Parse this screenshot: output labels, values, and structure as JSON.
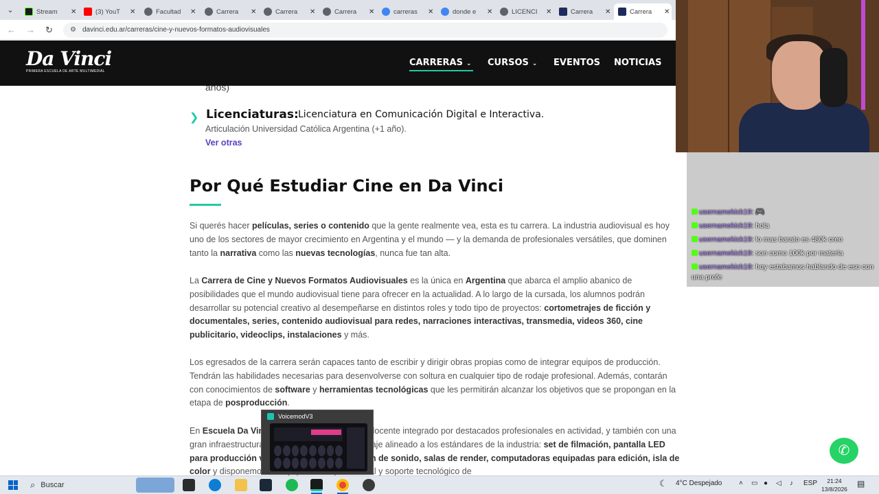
{
  "browser": {
    "tabs": [
      {
        "label": "Stream",
        "color": "#1a1a1a"
      },
      {
        "label": "(3) YouT",
        "color": "#ff0000"
      },
      {
        "label": "Facultad",
        "color": "#5f6368"
      },
      {
        "label": "Carrera",
        "color": "#5f6368"
      },
      {
        "label": "Carrera",
        "color": "#5f6368"
      },
      {
        "label": "Carrera",
        "color": "#5f6368"
      },
      {
        "label": "carreras",
        "color": "#4285f4"
      },
      {
        "label": "donde e",
        "color": "#4285f4"
      },
      {
        "label": "LICENCI",
        "color": "#5f6368"
      },
      {
        "label": "Carrera",
        "color": "#1e2b5c"
      },
      {
        "label": "Carrera",
        "color": "#1e2b5c"
      }
    ],
    "close_glyph": "✕",
    "url": "davinci.edu.ar/carreras/cine-y-nuevos-formatos-audiovisuales"
  },
  "site": {
    "logo_main": "Da Vinci",
    "logo_sub": "PRIMERA ESCUELA DE ARTE MULTIMEDIAL",
    "nav": {
      "carreras": "CARRERAS",
      "cursos": "CURSOS",
      "eventos": "EVENTOS",
      "noticias": "NOTICIAS"
    }
  },
  "content": {
    "fragment": "años)",
    "lic_title": "Licenciaturas:",
    "lic_body": "Licenciatura en Comunicación Digital e Interactiva.",
    "lic_sub": "Articulación Universidad Católica Argentina (+1 año).",
    "ver_otras": "Ver otras",
    "section_title": "Por Qué Estudiar Cine en Da Vinci",
    "p1": {
      "t1": "Si querés hacer ",
      "b1": "películas, series o contenido",
      "t2": " que la gente realmente vea, esta es tu carrera. La industria audiovisual es hoy uno de los sectores de mayor crecimiento en Argentina y el mundo — y la demanda de profesionales versátiles, que dominen tanto la ",
      "b2": "narrativa",
      "t3": " como las ",
      "b3": "nuevas tecnologías",
      "t4": ", nunca fue tan alta."
    },
    "p2": {
      "t1": "La ",
      "b1": "Carrera de Cine y Nuevos Formatos Audiovisuales",
      "t2": " es la única en ",
      "b2": "Argentina",
      "t3": " que abarca el amplio abanico de posibilidades que el mundo audiovisual tiene para ofrecer en la actualidad. A lo largo de la cursada, los alumnos podrán desarrollar su potencial creativo al desempeñarse en distintos roles y todo tipo de proyectos: ",
      "b3": "cortometrajes de ficción y documentales, series, contenido audiovisual para redes, narraciones interactivas, transmedia, videos 360, cine publicitario, videoclips, instalaciones",
      "t4": " y más."
    },
    "p3": {
      "t1": "Los egresados de la carrera serán capaces tanto de escribir y dirigir obras propias como de integrar equipos de producción. Tendrán las habilidades necesarias para desenvolverse con soltura en cualquier tipo de rodaje profesional. Además, contarán con conocimientos de ",
      "b1": "software",
      "t2": " y ",
      "b2": "herramientas tecnológicas",
      "t3": " que les permitirán alcanzar los objetivos que se propongan en la etapa de ",
      "b3": "posproducción",
      "t4": "."
    },
    "p4": {
      "t1": "En ",
      "b1": "Escuela Da Vinci",
      "t2": " contamos con un cuerpo docente integrado por destacados profesionales en actividad, y también con una gran infraestructura para garantizar un aprendizaje alineado a los estándares de la industria: ",
      "b2": "set de filmación, pantalla LED para producción virtual, estudio de grabación de sonido, salas de render, computadoras equipadas para edición, isla de color",
      "t3": " y disponemos de equipamiento profesional y soporte tecnológico de"
    }
  },
  "voicemod": {
    "title": "VoicemodV3"
  },
  "chat": [
    {
      "user": "usernamekick19:",
      "message": "🎮"
    },
    {
      "user": "usernamekick19:",
      "message": "hola"
    },
    {
      "user": "usernamekick19:",
      "message": "lo mas barato es 480k creo"
    },
    {
      "user": "usernamekick19:",
      "message": "son como 100k por materia"
    },
    {
      "user": "usernamekick19:",
      "message": "hoy estabamos hablando de eso con una profe"
    }
  ],
  "taskbar": {
    "search_label": "Buscar",
    "weather": "4°C  Despejado",
    "lang": "ESP",
    "time": "21:24",
    "date": "13/8/2026"
  },
  "colors": {
    "accent": "#22c9a6",
    "link": "#5a3fc0",
    "header_bg": "#111111"
  }
}
